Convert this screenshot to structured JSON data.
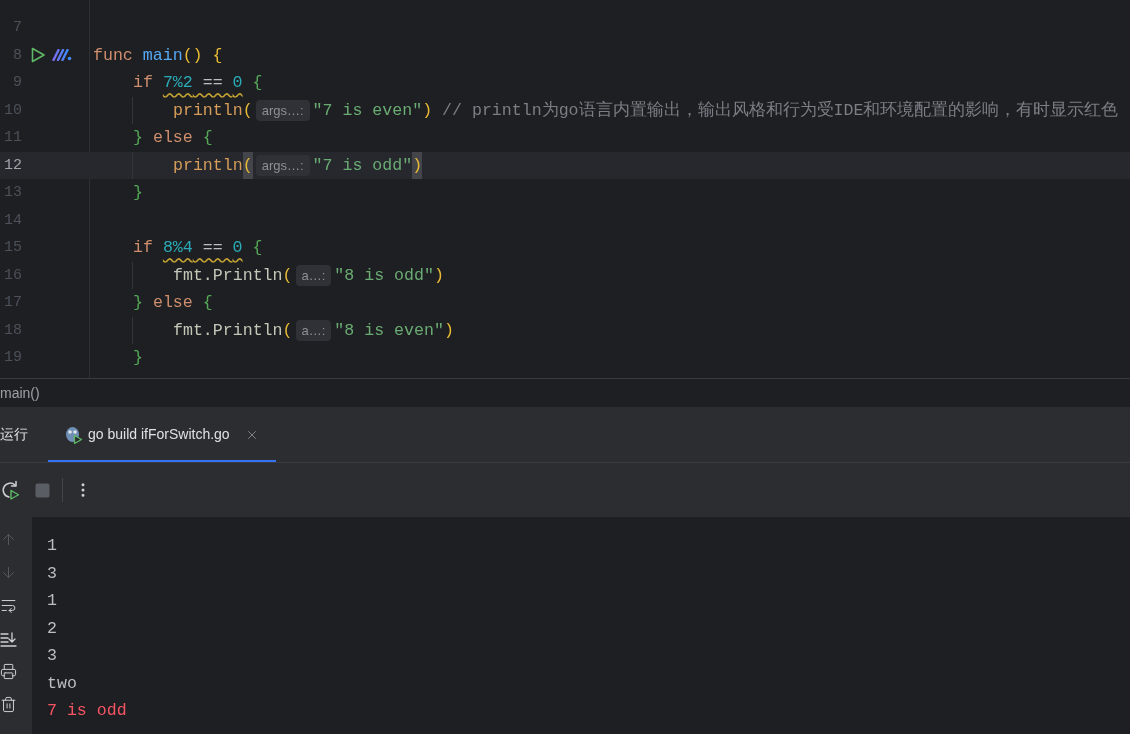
{
  "editor": {
    "lines": [
      {
        "number": "7",
        "current": false
      },
      {
        "number": "8",
        "current": false,
        "markers": [
          {
            "kind": "run"
          },
          {
            "kind": "ai"
          }
        ],
        "tokens": [
          {
            "text": "func ",
            "kind": "keyword"
          },
          {
            "text": "main",
            "kind": "function"
          },
          {
            "text": "()",
            "kind": "bracket"
          },
          {
            "text": " {",
            "kind": "bracket"
          }
        ],
        "children": [
          {
            "number": "9",
            "current": false,
            "tokens": [
              {
                "text": "if ",
                "kind": "keyword"
              },
              {
                "text": "7%2",
                "kind": "number",
                "warning": true
              },
              {
                "text": " == ",
                "kind": "operator",
                "warning": true
              },
              {
                "text": "0",
                "kind": "number",
                "warning": true
              },
              {
                "text": " {",
                "kind": "bracket"
              }
            ],
            "children": [
              {
                "number": "10",
                "current": false,
                "tokens": [
                  {
                    "text": "println",
                    "kind": "builtin"
                  },
                  {
                    "text": "(",
                    "kind": "bracket"
                  },
                  {
                    "text": "args…:",
                    "kind": "hint"
                  },
                  {
                    "text": "\"7 is even\"",
                    "kind": "string"
                  },
                  {
                    "text": ")",
                    "kind": "bracket"
                  },
                  {
                    "text": "// println为go语言内置输出，输出风格和行为受IDE和环境配置的影响，有时显示红色",
                    "kind": "comment"
                  }
                ]
              }
            ]
          },
          {
            "number": "11",
            "current": false,
            "tokens": [
              {
                "text": "}",
                "kind": "bracket"
              },
              {
                "text": " else ",
                "kind": "keyword"
              },
              {
                "text": "{",
                "kind": "bracket"
              }
            ],
            "children": [
              {
                "number": "12",
                "current": true,
                "tokens": [
                  {
                    "text": "println",
                    "kind": "builtin"
                  },
                  {
                    "text": "(",
                    "kind": "bracket",
                    "matched": true
                  },
                  {
                    "text": "args…:",
                    "kind": "hint"
                  },
                  {
                    "text": "\"7 is odd\"",
                    "kind": "string"
                  },
                  {
                    "text": ")",
                    "kind": "bracket",
                    "matched": true
                  }
                ]
              }
            ]
          },
          {
            "number": "13",
            "current": false,
            "tokens": [
              {
                "text": "}",
                "kind": "bracket"
              }
            ]
          },
          {
            "number": "14",
            "current": false
          },
          {
            "number": "15",
            "current": false,
            "tokens": [
              {
                "text": "if ",
                "kind": "keyword"
              },
              {
                "text": "8%4",
                "kind": "number",
                "warning": true
              },
              {
                "text": " == ",
                "kind": "operator",
                "warning": true
              },
              {
                "text": "0",
                "kind": "number",
                "warning": true
              },
              {
                "text": " {",
                "kind": "bracket"
              }
            ],
            "children": [
              {
                "number": "16",
                "current": false,
                "tokens": [
                  {
                    "text": "fmt.Println",
                    "kind": "plain"
                  },
                  {
                    "text": "(",
                    "kind": "bracket"
                  },
                  {
                    "text": "a…:",
                    "kind": "hint"
                  },
                  {
                    "text": "\"8 is odd\"",
                    "kind": "string"
                  },
                  {
                    "text": ")",
                    "kind": "bracket"
                  }
                ]
              }
            ]
          },
          {
            "number": "17",
            "current": false,
            "tokens": [
              {
                "text": "}",
                "kind": "bracket"
              },
              {
                "text": " else ",
                "kind": "keyword"
              },
              {
                "text": "{",
                "kind": "bracket"
              }
            ],
            "children": [
              {
                "number": "18",
                "current": false,
                "tokens": [
                  {
                    "text": "fmt.Println",
                    "kind": "plain"
                  },
                  {
                    "text": "(",
                    "kind": "bracket"
                  },
                  {
                    "text": "a…:",
                    "kind": "hint"
                  },
                  {
                    "text": "\"8 is even\"",
                    "kind": "string"
                  },
                  {
                    "text": ")",
                    "kind": "bracket"
                  }
                ]
              }
            ]
          },
          {
            "number": "19",
            "current": false,
            "tokens": [
              {
                "text": "}",
                "kind": "bracket"
              }
            ]
          }
        ]
      }
    ]
  },
  "breadcrumb": [
    "main()"
  ],
  "run_panel": {
    "title": "运行",
    "tabs": [
      {
        "label": "go build ifForSwitch.go",
        "selected": true,
        "closable": true
      }
    ],
    "console": [
      {
        "text": "1",
        "kind": "stdout"
      },
      {
        "text": "3",
        "kind": "stdout"
      },
      {
        "text": "1",
        "kind": "stdout"
      },
      {
        "text": "2",
        "kind": "stdout"
      },
      {
        "text": "3",
        "kind": "stdout"
      },
      {
        "text": "two",
        "kind": "stdout"
      },
      {
        "text": "7 is odd",
        "kind": "stderr"
      }
    ]
  }
}
